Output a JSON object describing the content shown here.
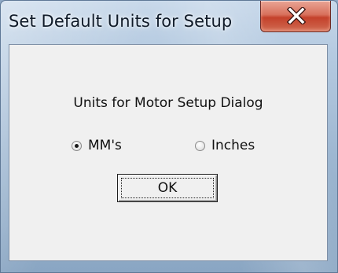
{
  "window": {
    "title": "Set Default Units for Setup"
  },
  "dialog": {
    "prompt": "Units for Motor Setup Dialog",
    "options": [
      {
        "label": "MM's",
        "checked": true
      },
      {
        "label": "Inches",
        "checked": false
      }
    ],
    "ok_label": "OK"
  },
  "icons": {
    "close": "close-icon"
  }
}
